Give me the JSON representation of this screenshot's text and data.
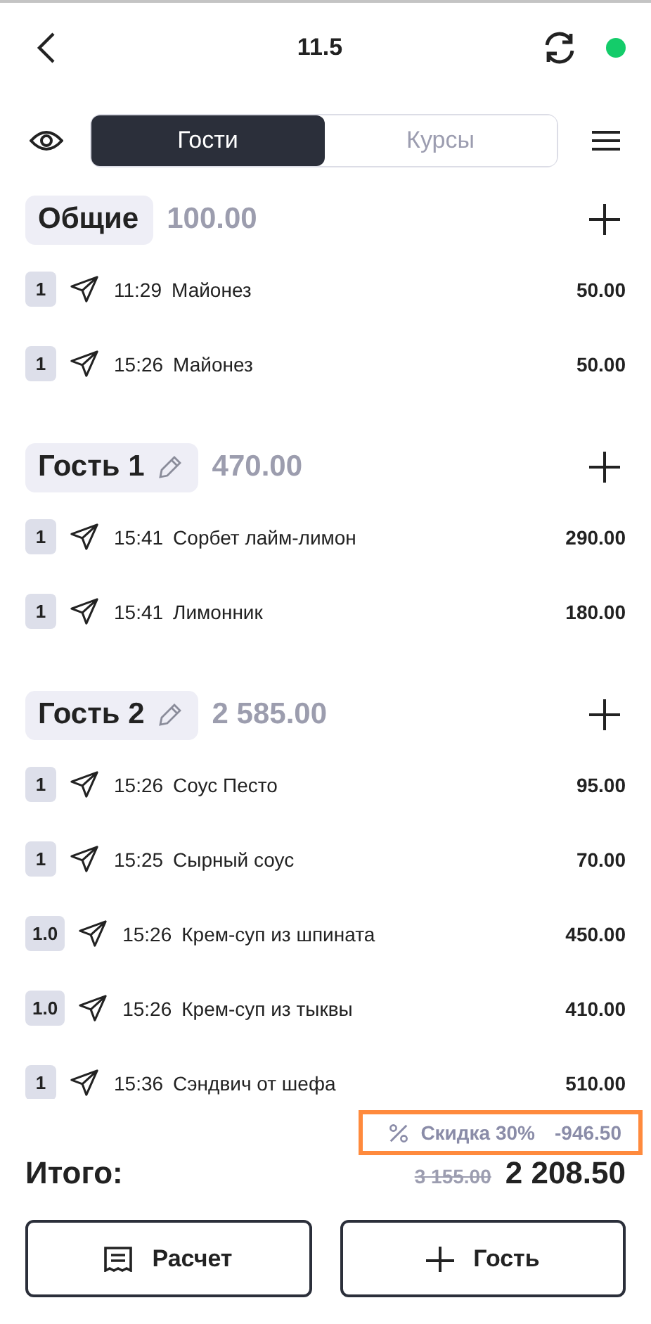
{
  "header": {
    "title": "11.5",
    "online": true
  },
  "tabs": [
    {
      "label": "Гости",
      "selected": true
    },
    {
      "label": "Курсы",
      "selected": false
    }
  ],
  "groups": [
    {
      "name": "Общие",
      "editable": false,
      "total": "100.00",
      "items": [
        {
          "qty": "1",
          "time": "11:29",
          "name": "Майонез",
          "price": "50.00"
        },
        {
          "qty": "1",
          "time": "15:26",
          "name": "Майонез",
          "price": "50.00"
        }
      ]
    },
    {
      "name": "Гость 1",
      "editable": true,
      "total": "470.00",
      "items": [
        {
          "qty": "1",
          "time": "15:41",
          "name": "Сорбет лайм-лимон",
          "price": "290.00"
        },
        {
          "qty": "1",
          "time": "15:41",
          "name": "Лимонник",
          "price": "180.00"
        }
      ]
    },
    {
      "name": "Гость 2",
      "editable": true,
      "total": "2 585.00",
      "items": [
        {
          "qty": "1",
          "time": "15:26",
          "name": "Соус Песто",
          "price": "95.00"
        },
        {
          "qty": "1",
          "time": "15:25",
          "name": "Сырный соус",
          "price": "70.00"
        },
        {
          "qty": "1.0",
          "time": "15:26",
          "name": "Крем-суп из шпината",
          "price": "450.00"
        },
        {
          "qty": "1.0",
          "time": "15:26",
          "name": "Крем-суп из тыквы",
          "price": "410.00"
        },
        {
          "qty": "1",
          "time": "15:36",
          "name": "Сэндвич от шефа",
          "price": "510.00"
        }
      ]
    }
  ],
  "discount": {
    "label": "Скидка 30%",
    "amount": "-946.50",
    "highlighted": true
  },
  "total": {
    "label": "Итого:",
    "old": "3 155.00",
    "value": "2 208.50"
  },
  "buttons": [
    {
      "kind": "bill",
      "label": "Расчет"
    },
    {
      "kind": "add",
      "label": "Гость"
    }
  ]
}
